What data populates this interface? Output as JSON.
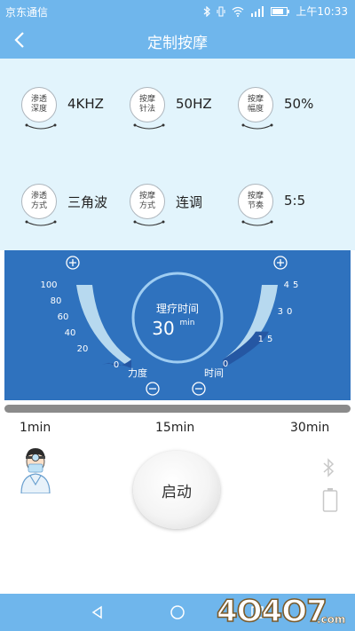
{
  "status_bar": {
    "carrier": "京东通信",
    "time": "上午10:33",
    "battery_level": "80%"
  },
  "header": {
    "title": "定制按摩",
    "back_icon": "chevron-left-icon"
  },
  "params": [
    {
      "label": "渗透深度",
      "value": "4KHZ"
    },
    {
      "label": "按摩针法",
      "value": "50HZ"
    },
    {
      "label": "按摩幅度",
      "value": "50%"
    },
    {
      "label": "渗透方式",
      "value": "三角波"
    },
    {
      "label": "按摩方式",
      "value": "连调"
    },
    {
      "label": "按摩节奏",
      "value": "5:5"
    }
  ],
  "dial": {
    "center_label": "理疗时间",
    "center_value": "30",
    "center_unit": "min",
    "strength": {
      "label": "力度",
      "ticks": [
        "100",
        "80",
        "60",
        "40",
        "20",
        "0"
      ],
      "level": 10
    },
    "time": {
      "label": "时间",
      "ticks": [
        "45",
        "30",
        "15",
        "0"
      ],
      "level": 30
    },
    "plus_icon": "plus-circle-icon",
    "minus_icon": "minus-circle-icon"
  },
  "progress": {
    "labels": [
      "1min",
      "15min",
      "30min"
    ]
  },
  "start_button": {
    "label": "启动"
  },
  "watermark": {
    "text": "4O4O7.com"
  }
}
